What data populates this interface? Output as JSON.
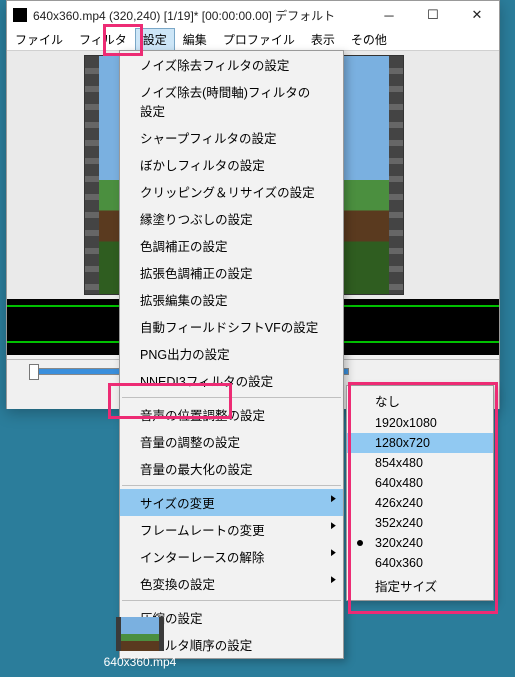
{
  "window": {
    "title": "640x360.mp4 (320,240) [1/19]* [00:00:00.00] デフォルト"
  },
  "menubar": {
    "items": [
      "ファイル",
      "フィルタ",
      "設定",
      "編集",
      "プロファイル",
      "表示",
      "その他"
    ]
  },
  "dropdown": {
    "items": [
      "ノイズ除去フィルタの設定",
      "ノイズ除去(時間軸)フィルタの設定",
      "シャープフィルタの設定",
      "ぼかしフィルタの設定",
      "クリッピング＆リサイズの設定",
      "縁塗りつぶしの設定",
      "色調補正の設定",
      "拡張色調補正の設定",
      "拡張編集の設定",
      "自動フィールドシフトVFの設定",
      "PNG出力の設定",
      "NNEDI3フィルタの設定",
      "音声の位置調整の設定",
      "音量の調整の設定",
      "音量の最大化の設定",
      "サイズの変更",
      "フレームレートの変更",
      "インターレースの解除",
      "色変換の設定",
      "圧縮の設定",
      "フィルタ順序の設定"
    ],
    "separators_after": [
      11,
      14,
      18
    ],
    "highlight_index": 15,
    "submenu_indices": [
      15,
      16,
      17,
      18
    ]
  },
  "submenu": {
    "items": [
      "なし",
      "1920x1080",
      "1280x720",
      "854x480",
      "640x480",
      "426x240",
      "352x240",
      "320x240",
      "640x360",
      "指定サイズ"
    ],
    "highlight_index": 2,
    "checked_index": 7
  },
  "transport_buttons": [
    "|◀",
    "▶|",
    "|◀",
    "▶|",
    "◀|",
    "|▶"
  ],
  "desktop": {
    "file_label": "640x360.mp4"
  }
}
